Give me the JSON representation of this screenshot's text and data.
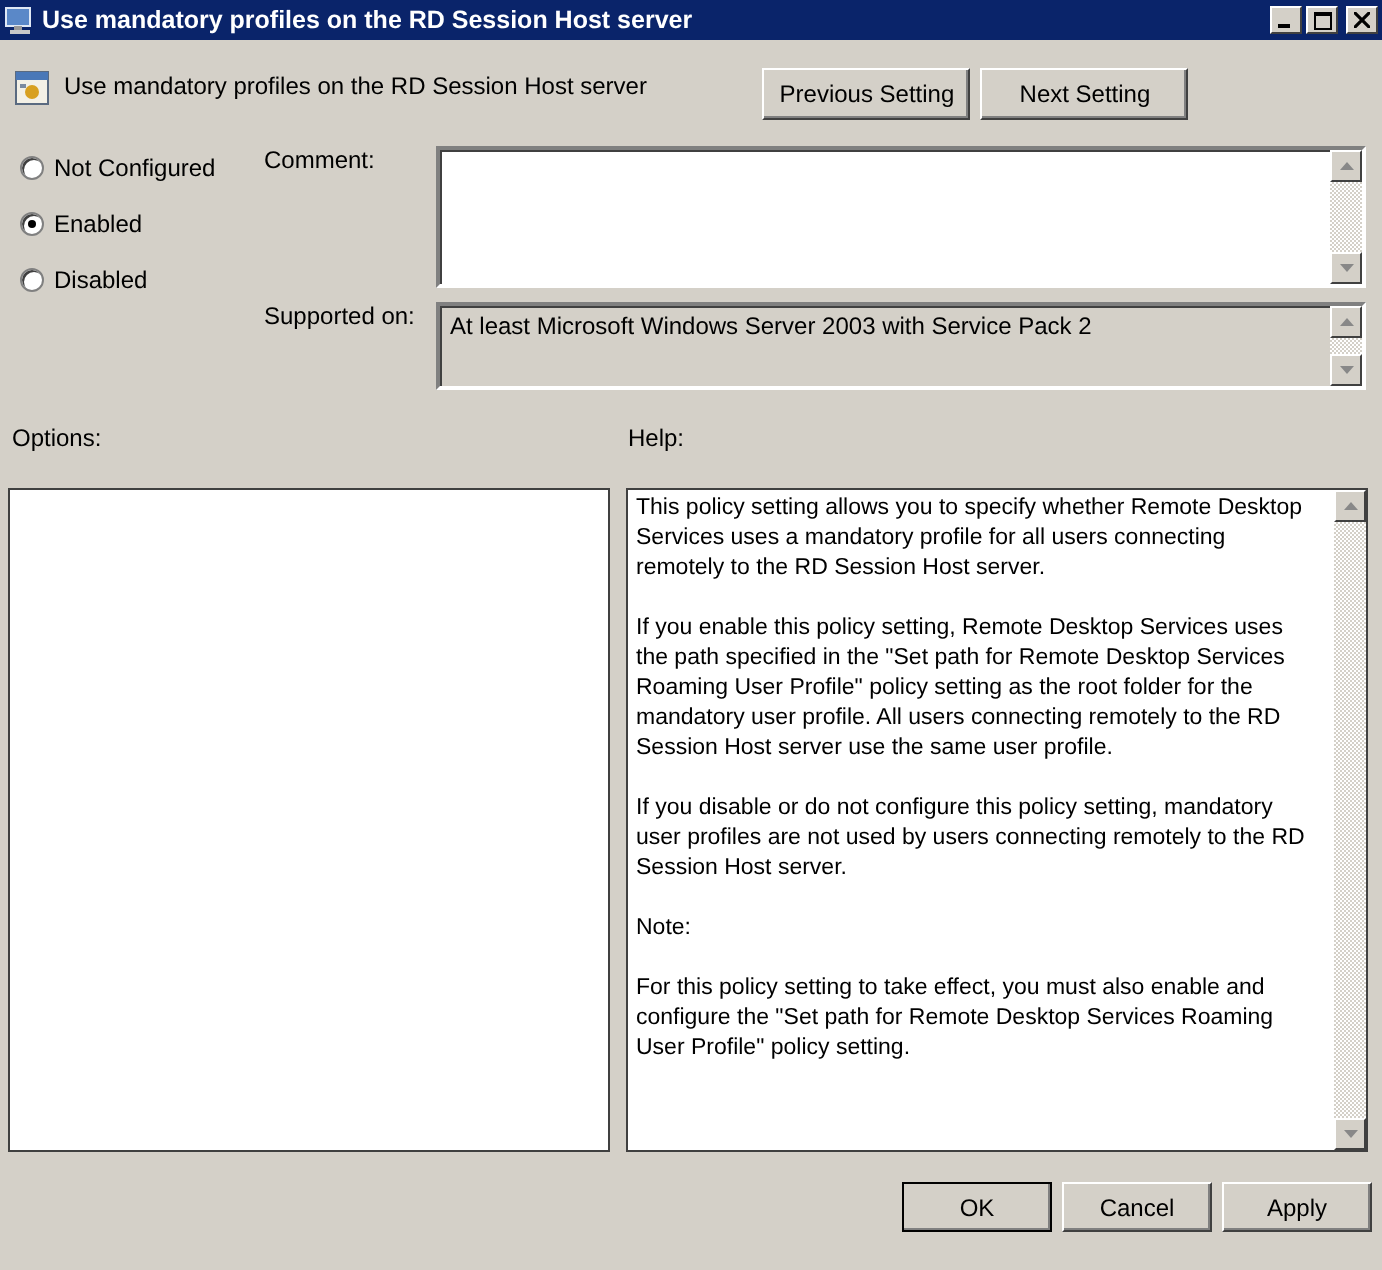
{
  "window": {
    "title": "Use mandatory profiles on the RD Session Host server"
  },
  "header": {
    "title": "Use mandatory profiles on the RD Session Host server"
  },
  "nav_buttons": [
    "Previous Setting",
    "Next Setting"
  ],
  "state_options": [
    {
      "label": "Not Configured",
      "selected": false
    },
    {
      "label": "Enabled",
      "selected": true
    },
    {
      "label": "Disabled",
      "selected": false
    }
  ],
  "comment": {
    "label": "Comment:"
  },
  "supported_on": {
    "label": "Supported on:",
    "value": "At least Microsoft Windows Server 2003 with Service Pack 2"
  },
  "options": {
    "label": "Options:"
  },
  "help": {
    "label": "Help:",
    "paragraphs": [
      "This policy setting allows you to specify whether Remote Desktop Services uses a mandatory profile for all users connecting remotely to the RD Session Host server.",
      "If you enable this policy setting, Remote Desktop Services uses the path specified in the \"Set path for Remote Desktop Services Roaming User Profile\" policy setting as the root folder for the mandatory user profile. All users connecting remotely to the RD Session Host server use the same user profile.",
      "If you disable or do not configure this policy setting, mandatory user profiles are not used by users connecting remotely to the RD Session Host server.",
      "Note:",
      "For this policy setting to take effect, you must also enable and configure the \"Set path for Remote Desktop Services Roaming User Profile\" policy setting."
    ]
  },
  "buttons": [
    {
      "label": "OK",
      "default": true
    },
    {
      "label": "Cancel",
      "default": false
    },
    {
      "label": "Apply",
      "default": false
    }
  ]
}
